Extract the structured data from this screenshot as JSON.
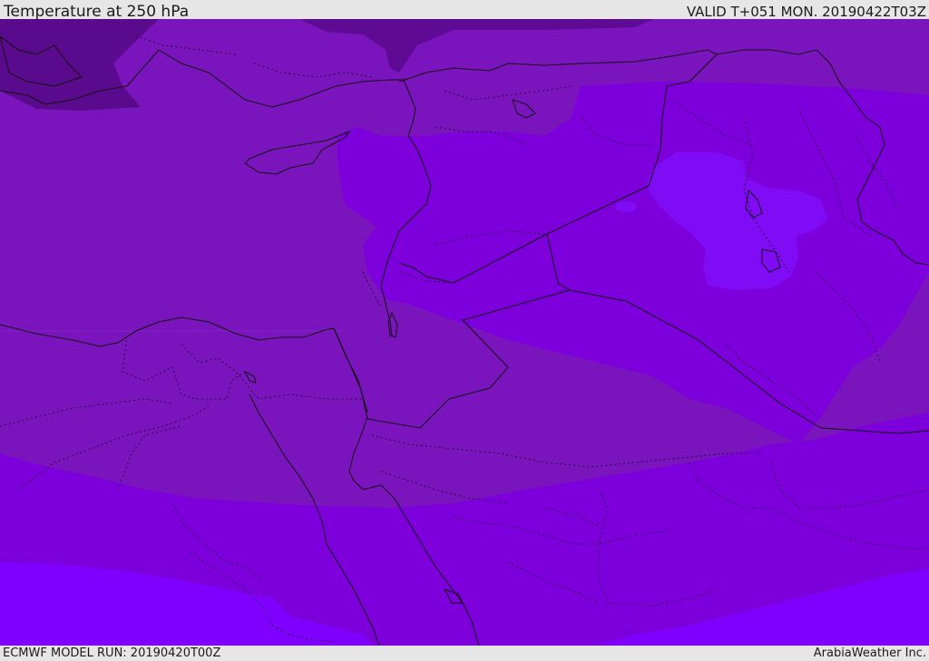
{
  "header": {
    "title": "Temperature at 250 hPa",
    "valid": "VALID T+051 MON. 20190422T03Z"
  },
  "footer": {
    "model_run": "ECMWF MODEL RUN: 20190420T00Z",
    "credit": "ArabiaWeather Inc."
  },
  "map": {
    "colors": {
      "darkest": "#5a0a8c",
      "dark": "#6f0fb0",
      "medium": "#7a14bd",
      "bright": "#7d00dc",
      "brighter": "#7f0cf5",
      "brightest": "#7f00ff",
      "border": "#111111"
    }
  }
}
